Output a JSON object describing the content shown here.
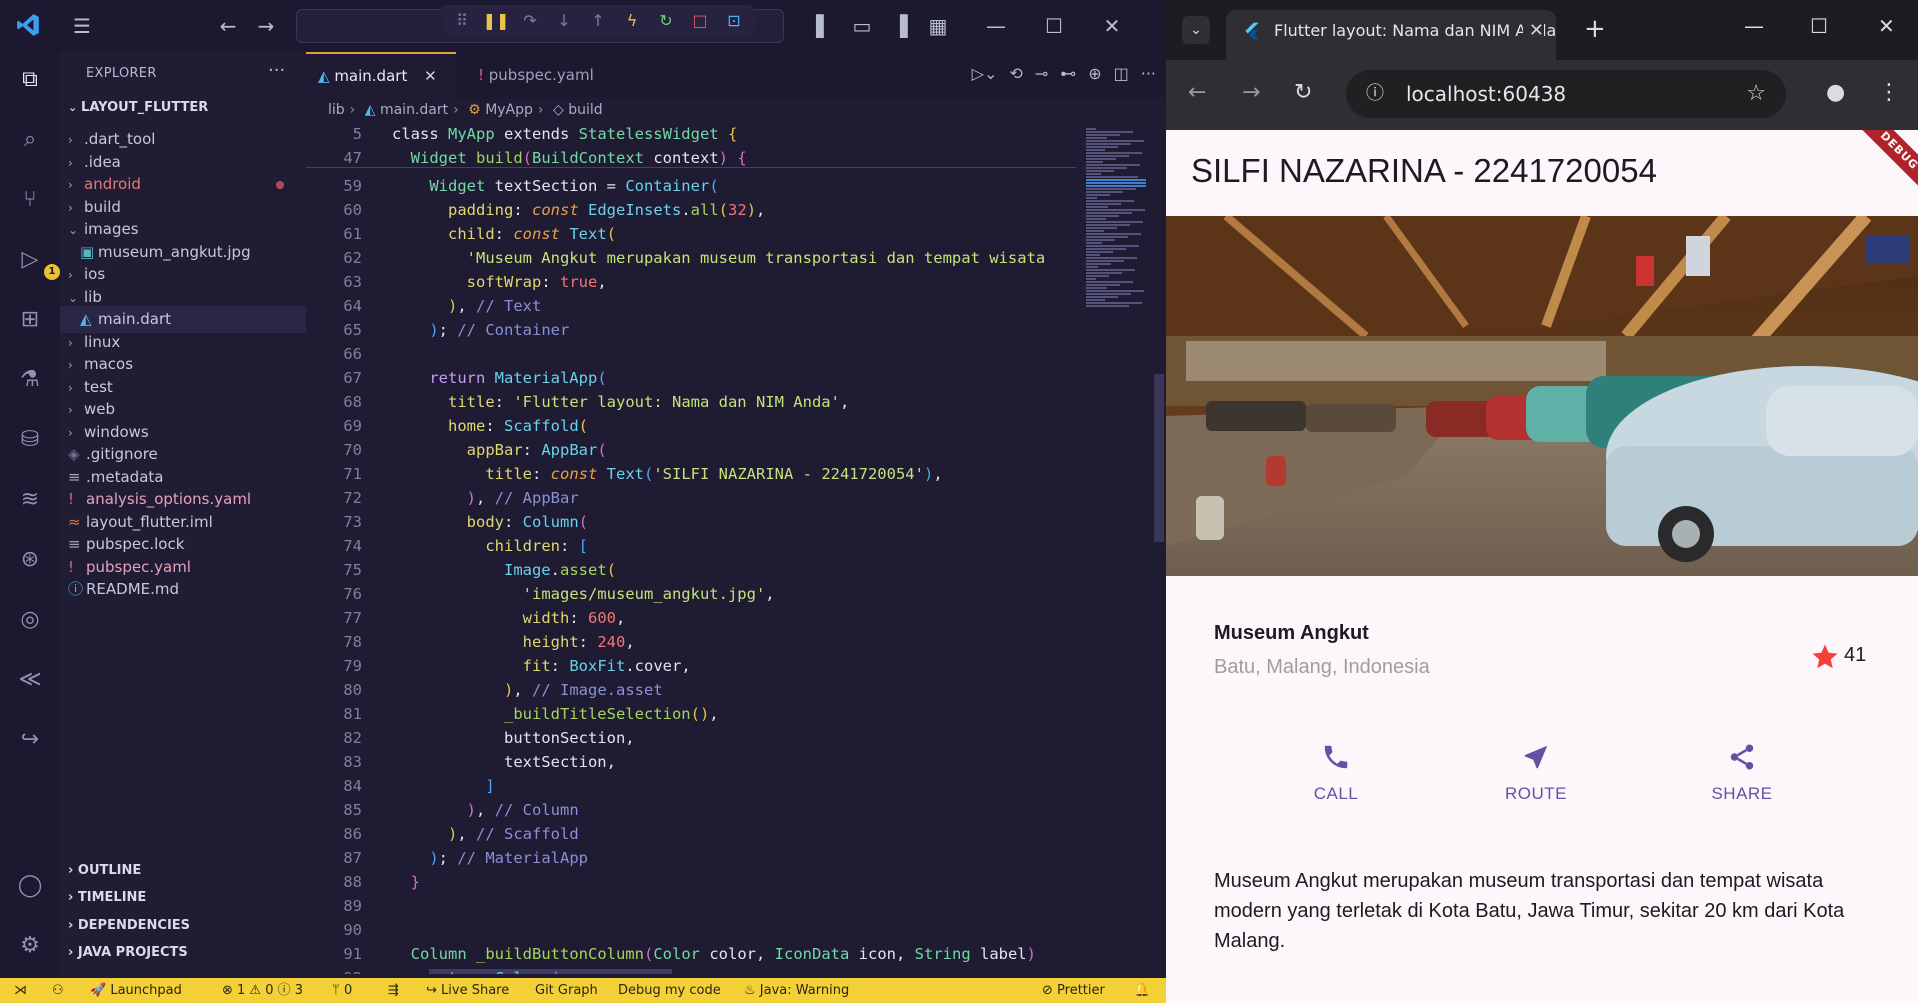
{
  "vscode": {
    "explorer_title": "EXPLORER",
    "project": "LAYOUT_FLUTTER",
    "tree": [
      {
        "label": ".dart_tool",
        "kind": "folder",
        "open": false
      },
      {
        "label": ".idea",
        "kind": "folder",
        "open": false
      },
      {
        "label": "android",
        "kind": "folder",
        "open": false
      },
      {
        "label": "build",
        "kind": "folder",
        "open": false
      },
      {
        "label": "images",
        "kind": "folder",
        "open": true
      },
      {
        "label": "museum_angkut.jpg",
        "kind": "image"
      },
      {
        "label": "ios",
        "kind": "folder",
        "open": false
      },
      {
        "label": "lib",
        "kind": "folder",
        "open": true
      },
      {
        "label": "main.dart",
        "kind": "dart"
      },
      {
        "label": "linux",
        "kind": "folder",
        "open": false
      },
      {
        "label": "macos",
        "kind": "folder",
        "open": false
      },
      {
        "label": "test",
        "kind": "folder",
        "open": false
      },
      {
        "label": "web",
        "kind": "folder",
        "open": false
      },
      {
        "label": "windows",
        "kind": "folder",
        "open": false
      },
      {
        "label": ".gitignore",
        "kind": "git"
      },
      {
        "label": ".metadata",
        "kind": "lines"
      },
      {
        "label": "analysis_options.yaml",
        "kind": "yaml"
      },
      {
        "label": "layout_flutter.iml",
        "kind": "rss"
      },
      {
        "label": "pubspec.lock",
        "kind": "lines"
      },
      {
        "label": "pubspec.yaml",
        "kind": "yaml"
      },
      {
        "label": "README.md",
        "kind": "info"
      }
    ],
    "sections": [
      "OUTLINE",
      "TIMELINE",
      "DEPENDENCIES",
      "JAVA PROJECTS"
    ],
    "tabs": [
      {
        "label": "main.dart",
        "active": true
      },
      {
        "label": "pubspec.yaml",
        "active": false
      }
    ],
    "breadcrumb": [
      "lib",
      "main.dart",
      "MyApp",
      "build"
    ],
    "debug_badge": "1",
    "status": {
      "launchpad": "Launchpad",
      "problems": "⊗ 1 ⚠ 0 ⓘ 3",
      "ports": "0",
      "live_share": "Live Share",
      "git_graph": "Git Graph",
      "debug": "Debug my code",
      "java": "Java: Warning",
      "prettier": "Prettier"
    }
  },
  "browser": {
    "tab_title": "Flutter layout: Nama dan NIM Anda",
    "url": "localhost:60438",
    "app": {
      "title": "SILFI NAZARINA - 2241720054",
      "debug_label": "DEBUG",
      "name": "Museum Angkut",
      "location": "Batu, Malang, Indonesia",
      "star_count": "41",
      "buttons": [
        "CALL",
        "ROUTE",
        "SHARE"
      ],
      "description": "Museum Angkut merupakan museum transportasi dan tempat wisata modern yang terletak di Kota Batu, Jawa Timur, sekitar 20 km dari Kota Malang.",
      "accent": "#6750a4",
      "star_color": "#f44336"
    }
  }
}
